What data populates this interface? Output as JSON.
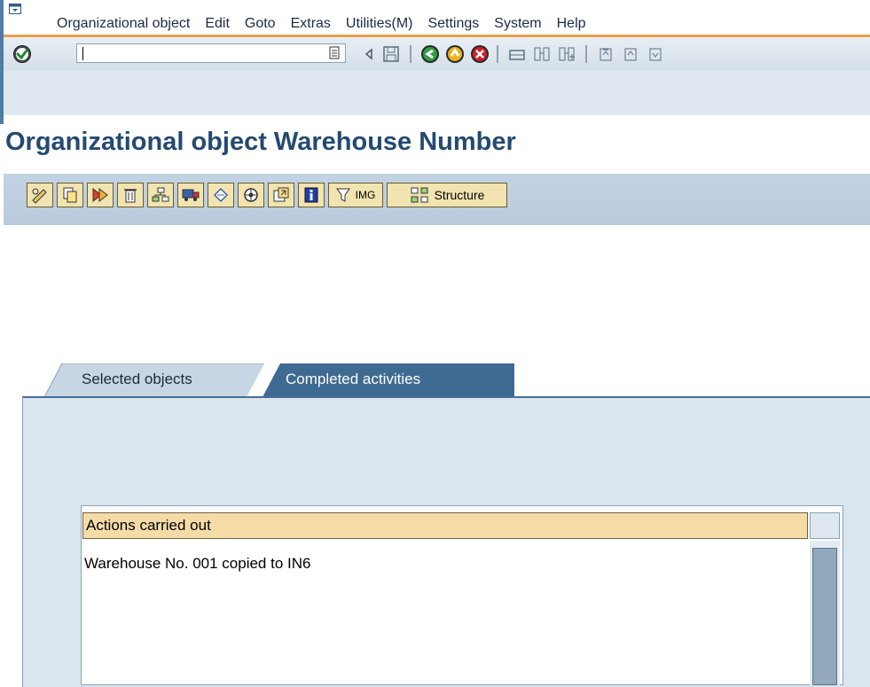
{
  "menubar": {
    "items": [
      {
        "label": "Organizational object"
      },
      {
        "label": "Edit"
      },
      {
        "label": "Goto"
      },
      {
        "label": "Extras"
      },
      {
        "label": "Utilities(M)"
      },
      {
        "label": "Settings"
      },
      {
        "label": "System"
      },
      {
        "label": "Help"
      }
    ]
  },
  "toolbar": {
    "command_value": "",
    "icons": [
      "enter-icon",
      "dropdown-icon",
      "back-arrow-icon",
      "save-icon",
      "back-icon",
      "exit-icon",
      "cancel-icon",
      "print-icon",
      "find-icon",
      "find-next-icon",
      "first-page-icon",
      "previous-page-icon",
      "next-page-icon"
    ]
  },
  "page": {
    "title": "Organizational object Warehouse Number"
  },
  "app_toolbar": {
    "img_label": "IMG",
    "structure_label": "Structure"
  },
  "tabs": {
    "selected_objects": "Selected objects",
    "completed_activities": "Completed activities"
  },
  "table": {
    "header": "Actions carried out",
    "rows": [
      "Warehouse No. 001 copied to IN6"
    ]
  },
  "colors": {
    "title": "#244a72",
    "accent_orange": "#e8a04b",
    "tab_active": "#3f6a92",
    "header_fill": "#f5dca7"
  }
}
